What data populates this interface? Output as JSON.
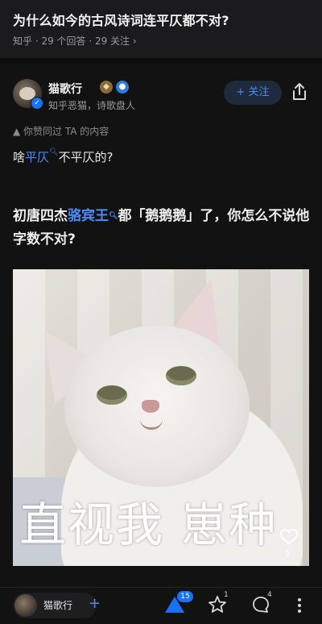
{
  "question": {
    "title": "为什么如今的古风诗词连平仄都不对?",
    "meta": "知乎 · 29 个回答 · 29 关注 ›"
  },
  "author": {
    "name": "猫歌行",
    "bio": "知乎恶猫，诗歌盘人",
    "follow_label": "+ 关注"
  },
  "answer": {
    "liked_note": "▲ 你赞同过 TA 的内容",
    "line1_pre": "啥",
    "line1_link": "平仄",
    "line1_post": "不平仄的?",
    "line2_pre": "初唐四杰",
    "line2_link": "骆宾王",
    "line2_post": "都「鹅鹅鹅」了，你怎么不说他字数不对?",
    "image_caption": "直视我 崽种",
    "image_likes": "1"
  },
  "bottom_bar": {
    "author_name": "猫歌行",
    "upvote_count": "15",
    "favorite_count": "1",
    "comment_count": "4"
  },
  "colors": {
    "background": "#121212",
    "accent": "#4a8cf7",
    "verify_blue": "#1772f6"
  }
}
